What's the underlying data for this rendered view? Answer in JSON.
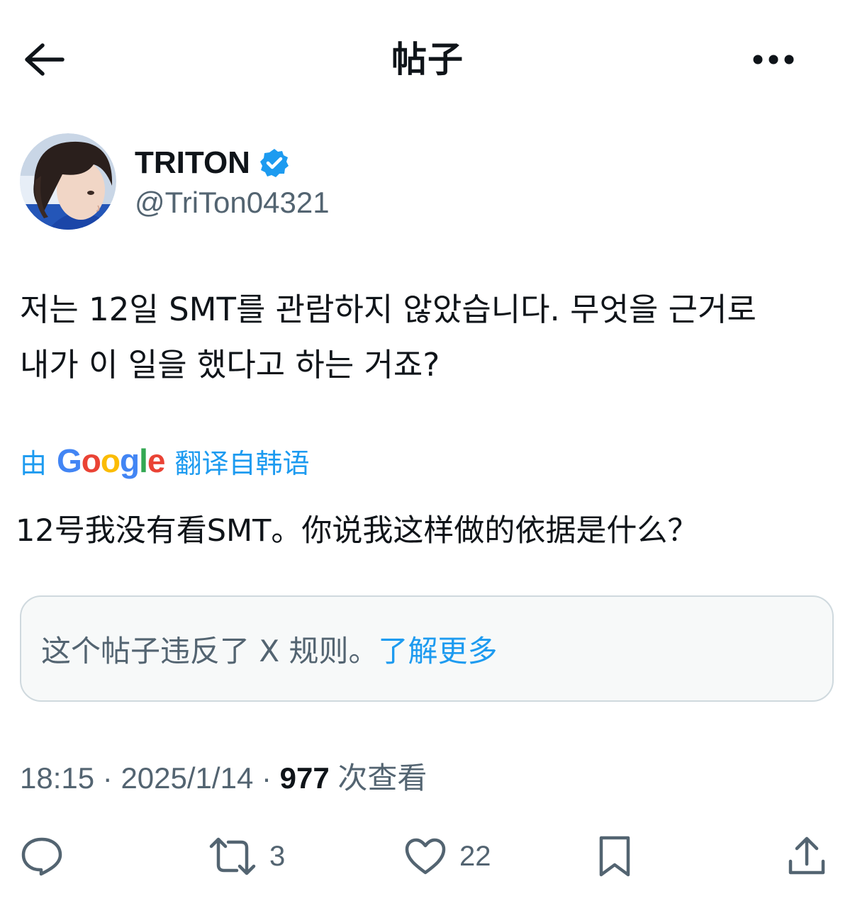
{
  "header": {
    "title": "帖子",
    "back_icon": "arrow-left-icon",
    "more_icon": "more-horizontal-icon"
  },
  "author": {
    "display_name": "TRITON",
    "handle": "@TriTon04321",
    "verified": true,
    "verified_color": "#1d9bf0"
  },
  "post": {
    "text_line1": "저는 12일 SMT를 관람하지 않았습니다. 무엇을 근거로",
    "text_line2": "내가 이 일을 했다고 하는 거죠?",
    "translate_prefix": "由",
    "translate_brand": "Google",
    "translate_suffix": "翻译自韩语",
    "translated_text": "12号我没有看SMT。你说我这样做的依据是什么？"
  },
  "notice": {
    "text": "这个帖子违反了 X 规则。",
    "link": "了解更多"
  },
  "meta": {
    "time": "18:15",
    "separator": "·",
    "date": "2025/1/14",
    "views_count": "977",
    "views_label": "次查看"
  },
  "actions": {
    "reply_count": "",
    "repost_count": "3",
    "like_count": "22",
    "bookmark_count": "",
    "share_count": ""
  },
  "colors": {
    "accent": "#1d9bf0",
    "text_primary": "#0f1419",
    "text_secondary": "#536471",
    "border": "#cfd9de"
  }
}
